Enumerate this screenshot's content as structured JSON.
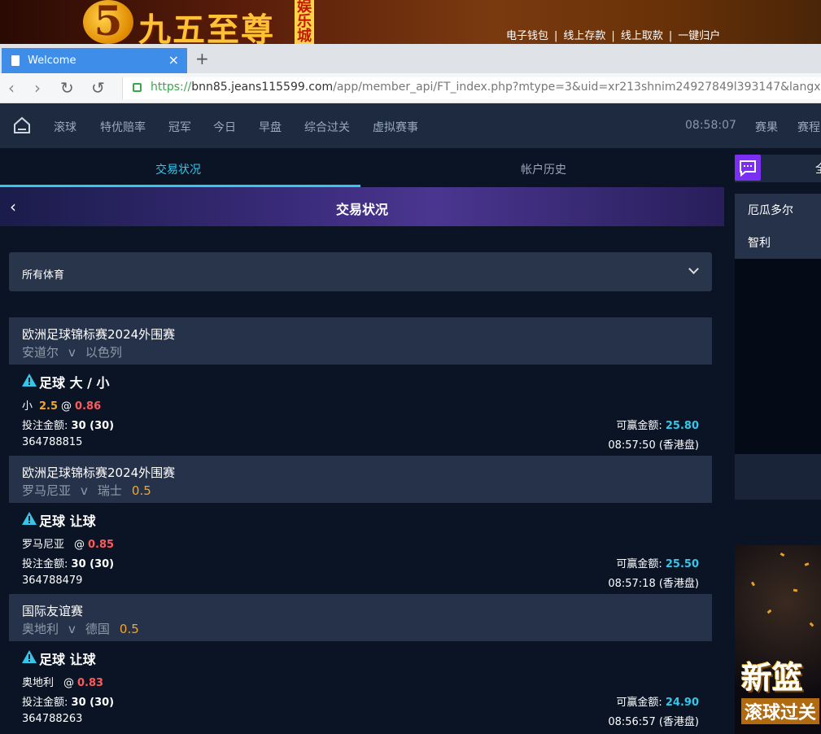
{
  "banner": {
    "logo_mark": "5",
    "logo_text": "九五至尊",
    "logo_sub": "娱乐城",
    "links": [
      "电子钱包",
      "线上存款",
      "线上取款",
      "一键归户"
    ],
    "separator": "|"
  },
  "browser": {
    "tab_title": "Welcome",
    "close_glyph": "×",
    "new_tab_glyph": "+",
    "url_scheme": "https://",
    "url_domain": "bnn85.jeans115599.com",
    "url_path": "/app/member_api/FT_index.php?mtype=3&uid=xr213shnim24927849l393147&langx=zh-cn",
    "back_glyph": "‹",
    "forward_glyph": "›",
    "reload_glyph": "↻",
    "undo_glyph": "↺"
  },
  "nav": {
    "items": [
      "滚球",
      "特优赔率",
      "冠军",
      "今日",
      "早盘",
      "综合过关",
      "虚拟赛事"
    ],
    "clock": "08:58:07",
    "right_items": [
      "赛果",
      "赛程"
    ]
  },
  "subtabs": {
    "active": "交易状况",
    "inactive": "帐户历史"
  },
  "header": {
    "back_glyph": "‹",
    "title": "交易状况"
  },
  "filter": {
    "selected": "所有体育"
  },
  "labels": {
    "stake": "投注金额:",
    "win": "可赢金额:",
    "at": "@",
    "vs": "v"
  },
  "bets": [
    {
      "league": "欧洲足球锦标赛2024外围赛",
      "home": "安道尔",
      "away": "以色列",
      "handicap": "",
      "bet_type": "足球 大 / 小",
      "selection": "小",
      "line": "2.5",
      "odds": "0.86",
      "stake": "30 (30)",
      "win": "25.80",
      "ticket": "364788815",
      "time": "08:57:50 (香港盘)"
    },
    {
      "league": "欧洲足球锦标赛2024外围赛",
      "home": "罗马尼亚",
      "away": "瑞士",
      "handicap": "0.5",
      "bet_type": "足球 让球",
      "selection": "罗马尼亚",
      "line": "",
      "odds": "0.85",
      "stake": "30 (30)",
      "win": "25.50",
      "ticket": "364788479",
      "time": "08:57:18 (香港盘)"
    },
    {
      "league": "国际友谊赛",
      "home": "奥地利",
      "away": "德国",
      "handicap": "0.5",
      "bet_type": "足球 让球",
      "selection": "奥地利",
      "line": "",
      "odds": "0.83",
      "stake": "30 (30)",
      "win": "24.90",
      "ticket": "364788263",
      "time": "08:56:57 (香港盘)"
    }
  ],
  "right_panel": {
    "top_text": "全",
    "items": [
      "厄瓜多尔",
      "智利"
    ],
    "promo_line1": "新篮",
    "promo_line2": "滚球过关"
  },
  "colors": {
    "accent": "#35c6e8",
    "odds": "#ff5a5a",
    "line": "#f5a623",
    "nav_bg": "#1e2a40",
    "page_bg": "#0b1424"
  }
}
